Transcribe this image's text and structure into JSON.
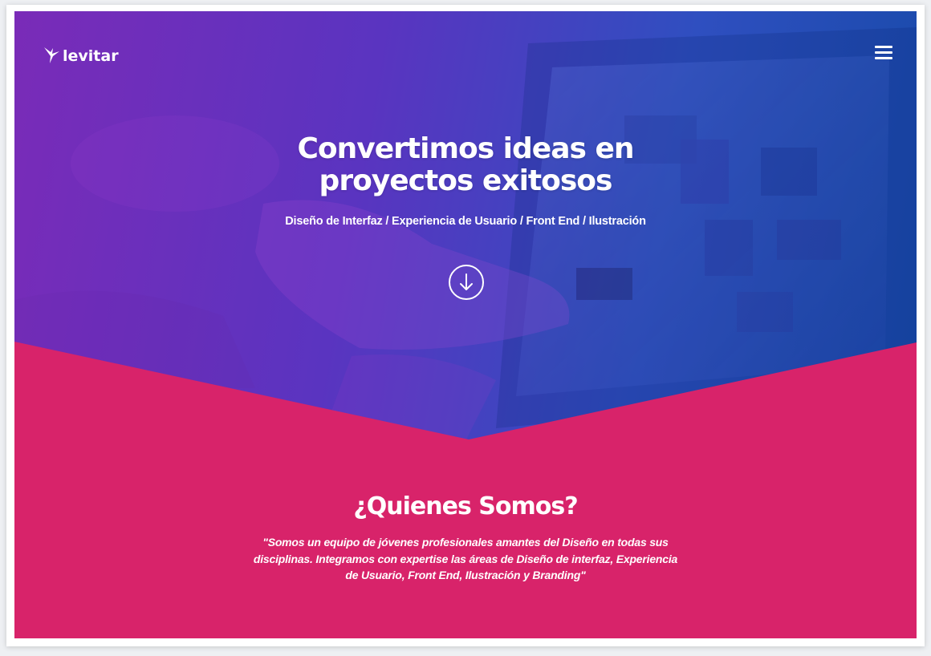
{
  "brand": {
    "logo_text": "levitar",
    "logo_icon": "hummingbird-icon"
  },
  "nav": {
    "menu_icon": "hamburger-menu-icon"
  },
  "hero": {
    "title_line1": "Convertimos ideas en",
    "title_line2": "proyectos exitosos",
    "subtitle": "Diseño de Interfaz / Experiencia de Usuario / Front End / Ilustración",
    "scroll_icon": "arrow-down-circle-icon"
  },
  "about": {
    "title": "¿Quienes Somos?",
    "quote": "\"Somos un equipo de jóvenes profesionales amantes del Diseño en todas sus disciplinas. Integramos con expertise las áreas de Diseño de interfaz, Experiencia de Usuario, Front End, Ilustración y Branding\""
  },
  "colors": {
    "hero_gradient_start": "#7a2bb8",
    "hero_gradient_end": "#174aa8",
    "accent_pink": "#d8236a",
    "text": "#ffffff"
  }
}
